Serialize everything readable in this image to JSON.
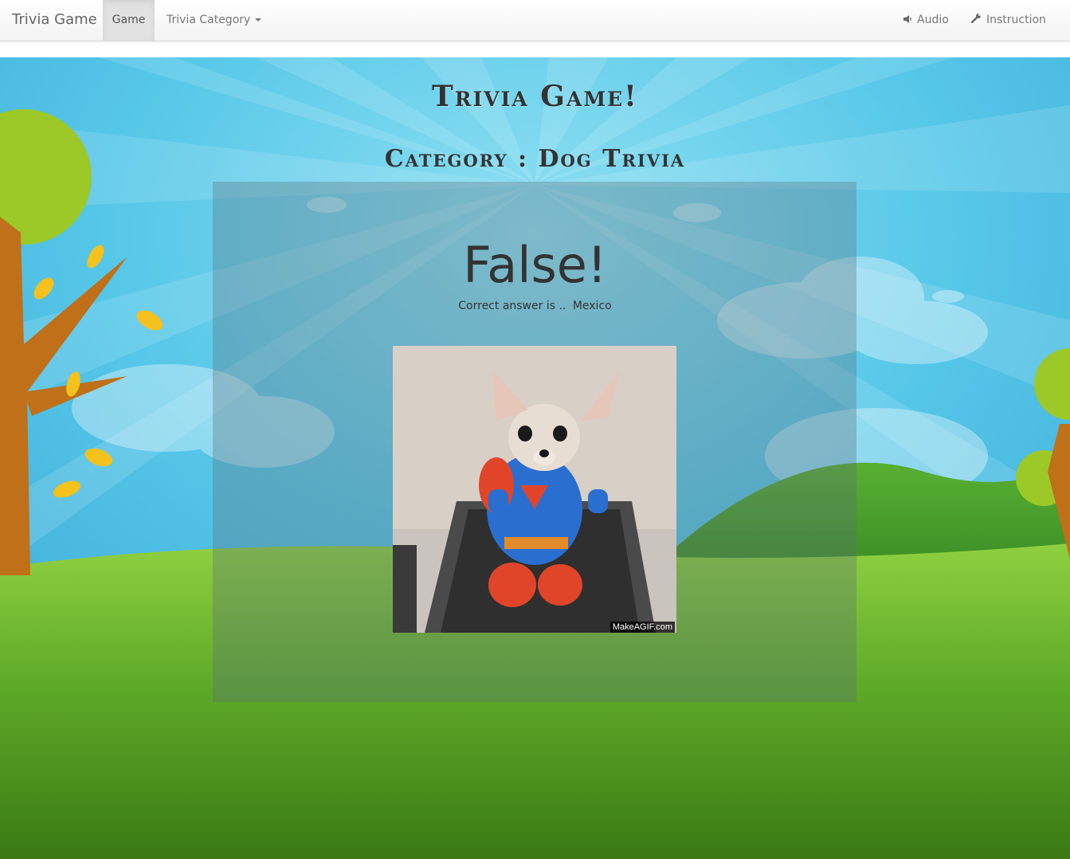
{
  "navbar": {
    "brand": "Trivia Game",
    "items": [
      {
        "label": "Game",
        "active": true
      },
      {
        "label": "Trivia Category",
        "dropdown": true
      },
      {
        "label": "Audio",
        "icon": "volume-icon"
      },
      {
        "label": "Instruction",
        "icon": "wrench-icon"
      }
    ]
  },
  "game": {
    "title": "Trivia Game!",
    "category_label": "Category",
    "category_separator": ":",
    "category_value": "Dog Trivia",
    "result": "False!",
    "answer_prefix": "Correct answer is ..",
    "answer_value": "Mexico",
    "image_watermark": "MakeAGIF.com"
  },
  "colors": {
    "sky": "#4ec3e6",
    "grass": "#5ea82a",
    "panel_overlay": "rgba(90,110,120,0.33)",
    "text_dark": "#333333"
  }
}
